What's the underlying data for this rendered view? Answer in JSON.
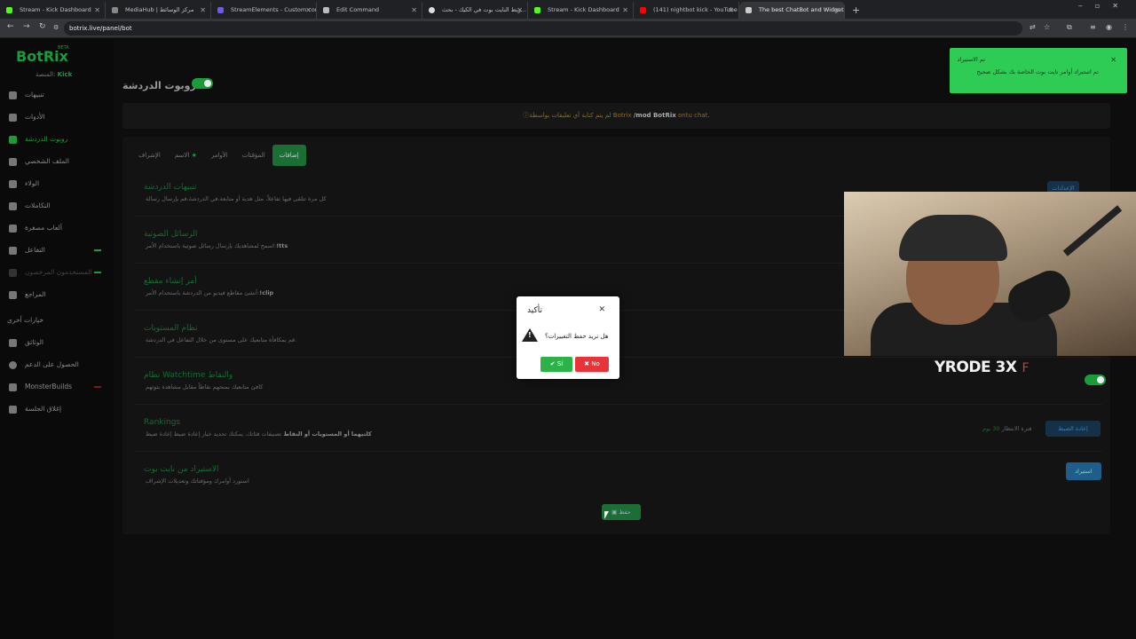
{
  "browser": {
    "tabs": [
      {
        "title": "Stream - Kick Dashboard",
        "color": "#53fc18"
      },
      {
        "title": "MediaHub | مركز الوسائط",
        "color": "#888888"
      },
      {
        "title": "StreamElements - Custom comm",
        "color": "#6c5ce7"
      },
      {
        "title": "Edit Command",
        "color": "#bbbbbb"
      },
      {
        "title": "ربط النايت بوت في الكيك - بحث...",
        "color": "#dddddd"
      },
      {
        "title": "Stream - Kick Dashboard",
        "color": "#53fc18"
      },
      {
        "title": "(141) nightbot kick - YouTube",
        "color": "#ff0000"
      },
      {
        "title": "The best ChatBot and Widgets",
        "color": "#cccccc"
      }
    ],
    "url": "botrix.live/panel/bot"
  },
  "sidebar": {
    "logo": "BotRix",
    "beta": "BETA",
    "platform_label": "المنصة:",
    "platform": "Kick",
    "items": [
      {
        "label": "تنبيهات"
      },
      {
        "label": "الأدوات"
      },
      {
        "label": "روبوت الدردشة"
      },
      {
        "label": "الملف الشخصي"
      },
      {
        "label": "الولاء"
      },
      {
        "label": "التكاملات"
      },
      {
        "label": "ألعاب مصغرة"
      },
      {
        "label": "التفاعل"
      },
      {
        "label": "المستخدمون المرخصون"
      },
      {
        "label": "المراجع"
      }
    ],
    "other_heading": "خيارات أخرى",
    "other_items": [
      {
        "label": "الوثائق"
      },
      {
        "label": "الحصول على الدعم"
      },
      {
        "label": "MonsterBuilds"
      },
      {
        "label": "إغلاق الجلسة"
      }
    ]
  },
  "page": {
    "title": "روبوت الدردشة",
    "banner_text": "لم يتم كتابة أي تعليقات بواسطة Botrix",
    "banner_cmd": "/mod BotRix",
    "banner_tail": "ontu chat.",
    "tabs": [
      "إضافات",
      "المؤقتات",
      "الأوامر",
      "الاسم",
      "الإشراف"
    ],
    "rows": [
      {
        "title": "تنبيهات الدردشة",
        "desc": "كل مرة تتلقى فيها تفاعلاً، مثل هدية أو متابعة،في الدردشة،قم بإرسال رسالة"
      },
      {
        "title": "الرسائل الصوتية",
        "desc": "اسمح لمشاهديك بإرسال رسائل صوتية باستخدام الأمر:",
        "cmd": "!tts"
      },
      {
        "title": "أمر إنشاء مقطع",
        "desc": "أنشئ مقاطع فيديو من الدردشة باستخدام الأمر:",
        "cmd": "!clip"
      },
      {
        "title": "نظام المستويات",
        "desc": "قم بمكافأة متابعيك على مستوى من خلال التفاعل في الدردشة."
      },
      {
        "title": "نظام Watchtime والنقاط",
        "desc": "كافئ متابعيك بمنحهم نقاطاً مقابل مشاهدة بثوثهم"
      },
      {
        "title": "Rankings",
        "desc": "تصنيفات فئاتك، يمكنك تحديد خيار إعادة ضبط إعادة ضبط",
        "bold": "كلتيهما أو المستويات أو النقاط"
      },
      {
        "title": "الاستيراد من نايت بوت",
        "desc": "استورد أوامرك ومؤقتاتك وتعديلات الإشراف"
      }
    ],
    "rankings_wait": "فترة الانتظار",
    "rankings_days": "30 يوم",
    "rankings_btn": "إعادة الضبط",
    "import_btn": "استيراد",
    "settings_btn": "الإعدادات",
    "save_btn": "حفظ"
  },
  "toast": {
    "title": "تم الاستيراد",
    "message": "تم استيراد أوامر نايت بوت الخاصة بك بشكل صحيح",
    "color": "#2ecc55"
  },
  "modal": {
    "title": "تأكيد",
    "question": "هل تريد حفظ التغييرات؟",
    "yes": "Sí",
    "no": "No"
  },
  "overlay": {
    "text": "YRODE 3X",
    "suffix": "F"
  }
}
